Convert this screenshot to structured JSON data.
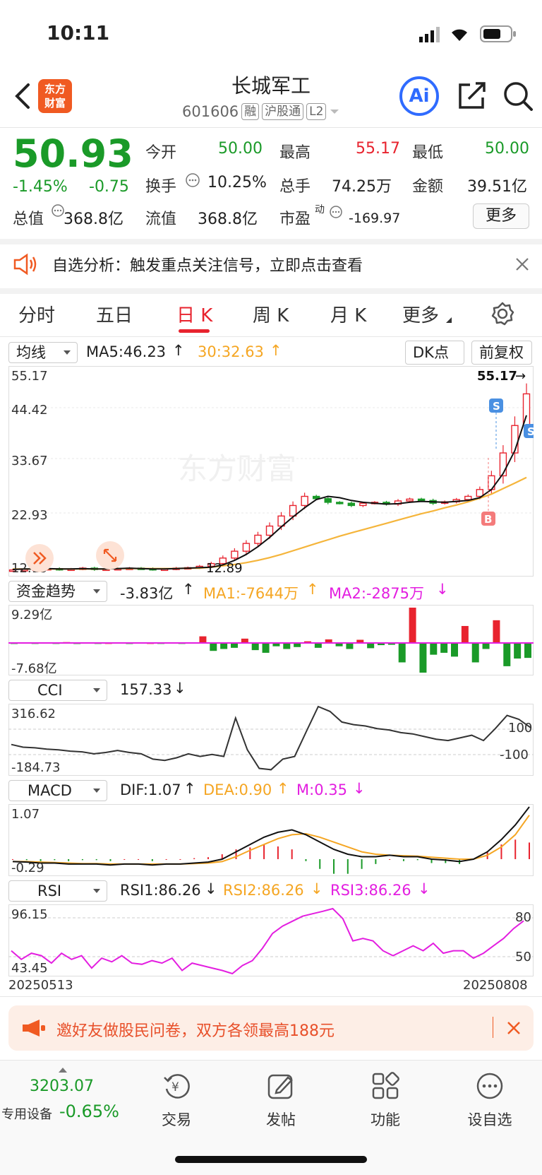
{
  "status": {
    "time": "10:11"
  },
  "header": {
    "title": "长城军工",
    "code": "601606",
    "tags": [
      "融",
      "沪股通",
      "L2"
    ],
    "logo_text_1": "东方",
    "logo_text_2": "财富",
    "ai_label": "Ai"
  },
  "quote": {
    "price": "50.93",
    "change_pct": "-1.45%",
    "change": "-0.75",
    "open_label": "今开",
    "open": "50.00",
    "high_label": "最高",
    "high": "55.17",
    "low_label": "最低",
    "low": "50.00",
    "turnover_label": "换手",
    "turnover": "10.25%",
    "volume_label": "总手",
    "volume": "74.25万",
    "amount_label": "金额",
    "amount": "39.51亿",
    "mktcap_label": "总值",
    "mktcap": "368.8亿",
    "float_label": "流值",
    "float": "368.8亿",
    "pe_label": "市盈",
    "pe_sup": "动",
    "pe": "-169.97",
    "more_label": "更多"
  },
  "notice": {
    "text": "自选分析：触发重点关注信号，立即点击查看"
  },
  "tabs": [
    "分时",
    "五日",
    "日 K",
    "周 K",
    "月 K",
    "更多"
  ],
  "kline": {
    "indicator_select": "均线",
    "ma5": "MA5:46.23",
    "ma30": "30:32.63",
    "dk_label": "DK点",
    "adjust_label": "前复权",
    "y_labels": [
      "55.17",
      "44.42",
      "33.67",
      "22.93",
      "12.19"
    ],
    "high_marker": "55.17",
    "low_marker": "12.89",
    "watermark": "东方财富",
    "s_label": "S",
    "b_label": "B"
  },
  "fund": {
    "select": "资金趋势",
    "value": "-3.83亿",
    "ma1": "MA1:-7644万",
    "ma2": "MA2:-2875万",
    "y_top": "9.29亿",
    "y_bottom": "-7.68亿"
  },
  "cci": {
    "select": "CCI",
    "value": "157.33",
    "y_top": "316.62",
    "y_bottom": "-184.73",
    "ref_top": "100",
    "ref_bottom": "-100"
  },
  "macd": {
    "select": "MACD",
    "dif": "DIF:1.07",
    "dea": "DEA:0.90",
    "m": "M:0.35",
    "y_top": "1.07",
    "y_bottom": "-0.29"
  },
  "rsi": {
    "select": "RSI",
    "rsi1": "RSI1:86.26",
    "rsi2": "RSI2:86.26",
    "rsi3": "RSI3:86.26",
    "y_top": "96.15",
    "y_bottom": "43.45",
    "ref_top": "80",
    "ref_bottom": "50"
  },
  "dates": {
    "start": "20250513",
    "end": "20250808"
  },
  "banner": {
    "text": "邀好友做股民问卷，双方各领最高188元"
  },
  "nav": {
    "index_value": "3203.07",
    "index_label": "专用设备",
    "index_change": "-0.65%",
    "items": [
      "交易",
      "发帖",
      "功能",
      "设自选"
    ]
  },
  "colors": {
    "up": "#e8232e",
    "down": "#1a9a28",
    "ma30": "#f5a623",
    "magenta": "#e31ee0",
    "brand": "#f05a22",
    "ai": "#2f6bff"
  },
  "chart_data": [
    {
      "type": "candlestick",
      "title": "",
      "series": [
        {
          "name": "MA5",
          "values": [
            12.5,
            12.6,
            12.6,
            12.7,
            12.6,
            12.6,
            12.7,
            12.6,
            12.6,
            12.7,
            12.8,
            12.7,
            12.6,
            12.6,
            12.7,
            12.8,
            12.9,
            13.0,
            13.5,
            14.5,
            15.8,
            17.5,
            19.5,
            21.8,
            24.0,
            26.0,
            27.8,
            28.5,
            28.2,
            27.6,
            27.2,
            27.0,
            26.8,
            26.9,
            27.2,
            27.4,
            27.3,
            27.2,
            27.4,
            27.6,
            28.2,
            30.0,
            33.5,
            38.5,
            46.23
          ]
        },
        {
          "name": "MA30",
          "values": [
            12.6,
            12.6,
            12.6,
            12.6,
            12.6,
            12.6,
            12.6,
            12.6,
            12.6,
            12.7,
            12.7,
            12.7,
            12.7,
            12.7,
            12.7,
            12.8,
            12.8,
            13.0,
            13.3,
            13.6,
            14.0,
            14.5,
            15.1,
            15.8,
            16.6,
            17.4,
            18.2,
            19.0,
            19.8,
            20.5,
            21.2,
            21.9,
            22.6,
            23.3,
            24.0,
            24.7,
            25.3,
            26.0,
            26.6,
            27.3,
            28.1,
            29.0,
            30.2,
            31.4,
            32.63
          ]
        },
        {
          "name": "close",
          "values": [
            12.4,
            12.5,
            12.6,
            12.7,
            12.5,
            12.6,
            12.8,
            12.5,
            12.6,
            12.7,
            12.8,
            12.7,
            12.5,
            12.6,
            12.8,
            12.9,
            13.2,
            13.8,
            15.0,
            16.5,
            18.2,
            20.0,
            22.0,
            24.2,
            26.5,
            28.5,
            28.0,
            27.2,
            27.0,
            26.5,
            27.0,
            27.2,
            26.8,
            27.5,
            27.9,
            27.6,
            27.0,
            27.3,
            27.8,
            28.5,
            30.0,
            33.0,
            38.0,
            44.0,
            50.93
          ]
        }
      ],
      "ylim": [
        12.19,
        55.17
      ]
    },
    {
      "type": "bar",
      "title": "",
      "series": [
        {
          "name": "资金趋势",
          "values": [
            -0.2,
            0.1,
            -0.1,
            0.2,
            -0.1,
            0.3,
            -0.2,
            0.1,
            -0.1,
            0.0,
            0.1,
            -0.2,
            0.1,
            0.0,
            -0.1,
            0.2,
            -0.1,
            0.1,
            1.8,
            -2.0,
            -1.5,
            -1.2,
            1.2,
            -1.8,
            -2.5,
            -0.8,
            -1.5,
            -1.0,
            0.5,
            -1.2,
            1.0,
            -0.8,
            -1.5,
            0.9,
            -1.3,
            -0.5,
            -0.4,
            -5.0,
            9.29,
            -7.68,
            -3.0,
            -2.5,
            -3.5,
            4.5,
            -5.0,
            -1.5,
            6.0,
            -6.0,
            -4.0,
            -3.83
          ]
        }
      ],
      "ylim": [
        -7.68,
        9.29
      ]
    },
    {
      "type": "line",
      "title": "",
      "series": [
        {
          "name": "CCI",
          "values": [
            30,
            10,
            5,
            -5,
            -10,
            -20,
            -25,
            -40,
            -30,
            -15,
            -30,
            -40,
            -80,
            -90,
            -70,
            -40,
            -60,
            -45,
            -60,
            230,
            -10,
            -150,
            -160,
            -80,
            -60,
            130,
            316.62,
            280,
            200,
            180,
            170,
            150,
            140,
            120,
            110,
            90,
            70,
            60,
            80,
            100,
            60,
            150,
            250,
            220,
            157.33
          ]
        }
      ],
      "ylim": [
        -184.73,
        316.62
      ]
    },
    {
      "type": "line",
      "title": "",
      "series": [
        {
          "name": "DIF",
          "values": [
            -0.05,
            -0.06,
            -0.08,
            -0.08,
            -0.1,
            -0.1,
            -0.1,
            -0.12,
            -0.1,
            -0.1,
            -0.12,
            -0.1,
            -0.1,
            -0.08,
            -0.06,
            0.0,
            0.15,
            0.3,
            0.45,
            0.55,
            0.6,
            0.5,
            0.35,
            0.2,
            0.1,
            0.05,
            0.05,
            0.08,
            0.05,
            0.05,
            0.0,
            -0.02,
            -0.05,
            0.0,
            0.15,
            0.4,
            0.7,
            1.07
          ]
        },
        {
          "name": "DEA",
          "values": [
            -0.05,
            -0.05,
            -0.06,
            -0.07,
            -0.08,
            -0.09,
            -0.09,
            -0.1,
            -0.1,
            -0.1,
            -0.1,
            -0.1,
            -0.1,
            -0.09,
            -0.08,
            -0.05,
            0.05,
            0.18,
            0.3,
            0.42,
            0.5,
            0.52,
            0.45,
            0.35,
            0.25,
            0.15,
            0.1,
            0.08,
            0.07,
            0.06,
            0.04,
            0.02,
            0.0,
            0.0,
            0.08,
            0.25,
            0.5,
            0.9
          ]
        }
      ],
      "ylim": [
        -0.29,
        1.07
      ]
    },
    {
      "type": "line",
      "title": "",
      "series": [
        {
          "name": "RSI1",
          "values": [
            62,
            55,
            60,
            58,
            52,
            60,
            55,
            58,
            48,
            56,
            53,
            58,
            52,
            51,
            54,
            52,
            56,
            46,
            52,
            50,
            48,
            46,
            43.45,
            50,
            54,
            64,
            76,
            82,
            86,
            90,
            92,
            94,
            96.15,
            88,
            70,
            72,
            70,
            62,
            58,
            62,
            66,
            62,
            68,
            60,
            62,
            62,
            56,
            60,
            66,
            72,
            80,
            86.26
          ]
        }
      ],
      "ylim": [
        43.45,
        96.15
      ]
    }
  ]
}
